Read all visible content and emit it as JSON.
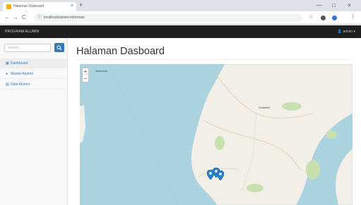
{
  "browser": {
    "tab_title": "Halaman Dasboard",
    "tab_close": "×",
    "new_tab": "+",
    "url": "localhost/sistem-informasi",
    "win_min": "—",
    "win_max": "□",
    "win_close": "×",
    "back": "←",
    "forward": "→",
    "reload": "C",
    "info": "ⓘ",
    "star": "☆",
    "menu_dots": "⋮"
  },
  "navbar": {
    "brand": "PROGRAM ALUMNI",
    "user_menu": "👤 admin ▾"
  },
  "sidebar": {
    "search_placeholder": "Search...",
    "items": [
      {
        "label": "Dashboard",
        "icon": "dashboard-icon",
        "active": true
      },
      {
        "label": "Master Alumni",
        "icon": "user-icon",
        "active": false
      },
      {
        "label": "Data Alumni",
        "icon": "table-icon",
        "active": false
      }
    ]
  },
  "main": {
    "title": "Halaman Dasboard"
  },
  "map": {
    "zoom_in": "+",
    "zoom_out": "−",
    "labels": {
      "sea": "Makassar",
      "city": "Sulawesi"
    },
    "marker_color": "#2a81cb",
    "colors": {
      "water": "#aad3df",
      "land": "#f2efe9",
      "park": "#c8dfb0"
    }
  }
}
